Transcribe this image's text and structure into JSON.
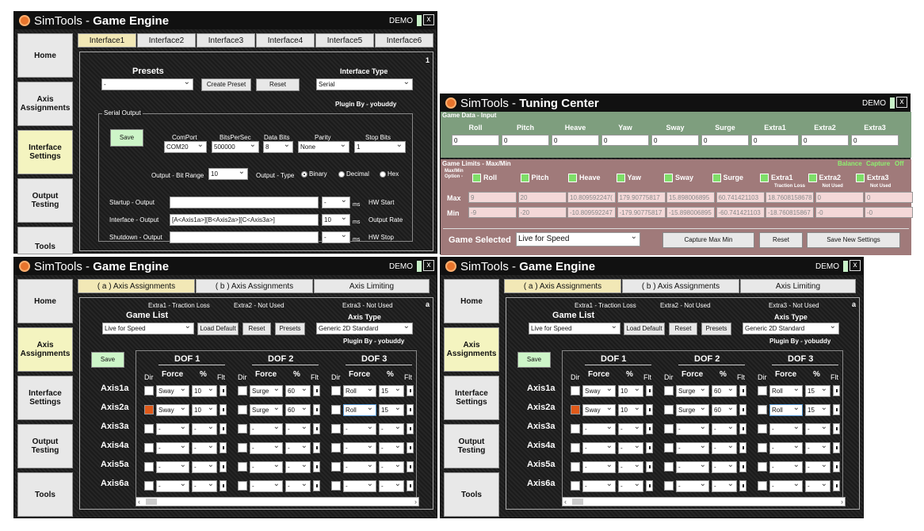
{
  "app": {
    "name": "SimTools",
    "game_engine": "Game Engine",
    "tuning_center": "Tuning Center",
    "demo": "DEMO",
    "close": "x"
  },
  "side_nav": [
    "Home",
    "Axis Assignments",
    "Interface Settings",
    "Output Testing",
    "Tools"
  ],
  "win1": {
    "tabs": [
      "Interface1",
      "Interface2",
      "Interface3",
      "Interface4",
      "Interface5",
      "Interface6"
    ],
    "page_num": "1",
    "presets_label": "Presets",
    "presets_value": "-",
    "create_preset": "Create Preset",
    "reset": "Reset",
    "interface_type_label": "Interface Type",
    "interface_type_value": "Serial",
    "plugin_by": "Plugin By - yobuddy",
    "serial_output": "Serial Output",
    "save": "Save",
    "comport_label": "ComPort",
    "comport": "COM20",
    "bps_label": "BitsPerSec",
    "bps": "500000",
    "databits_label": "Data Bits",
    "databits": "8",
    "parity_label": "Parity",
    "parity": "None",
    "stopbits_label": "Stop Bits",
    "stopbits": "1",
    "bitrange_label": "Output - Bit Range",
    "bitrange": "10",
    "outtype_label": "Output - Type",
    "binary": "Binary",
    "decimal": "Decimal",
    "hex": "Hex",
    "startup_label": "Startup - Output",
    "startup_value": "",
    "startup_ms": "-",
    "hw_start": "HW Start",
    "interface_label": "Interface - Output",
    "interface_value": "[A<Axis1a>][B<Axis2a>][C<Axis3a>]",
    "interface_ms": "10",
    "output_rate": "Output Rate",
    "shutdown_label": "Shutdown - Output",
    "shutdown_value": "",
    "shutdown_ms": "-",
    "hw_stop": "HW Stop",
    "ms": "ms"
  },
  "tuning": {
    "game_data_label": "Game Data - Input",
    "channels": [
      "Roll",
      "Pitch",
      "Heave",
      "Yaw",
      "Sway",
      "Surge",
      "Extra1",
      "Extra2",
      "Extra3"
    ],
    "inputs": [
      "0",
      "0",
      "0",
      "0",
      "0",
      "0",
      "0",
      "0",
      "0"
    ],
    "limits_label": "Game Limits - Max/Min",
    "balance": "Balance",
    "capture": "Capture",
    "off": "Off",
    "maxmin_option": "Max/Min Option -",
    "notes": [
      "",
      "",
      "",
      "",
      "",
      "",
      "Traction Loss",
      "Not Used",
      "Not Used"
    ],
    "max_label": "Max",
    "min_label": "Min",
    "max": [
      "9",
      "20",
      "10.809592247(",
      "179.90775817",
      "15.898006895",
      "60.741421103",
      "18.7608158678",
      "0",
      "0"
    ],
    "min": [
      "-9",
      "-20",
      "-10.809592247",
      "-179.90775817",
      "-15.898006895",
      "-60.741421103",
      "-18.760815867",
      "-0",
      "-0"
    ],
    "game_selected_label": "Game Selected",
    "game_selected": "Live for Speed",
    "capture_max_min": "Capture Max Min",
    "reset": "Reset",
    "save_new": "Save New Settings"
  },
  "axis": {
    "tabs": [
      "( a ) Axis Assignments",
      "( b ) Axis Assignments",
      "Axis Limiting"
    ],
    "page": "a",
    "extra1": "Extra1 - Traction Loss",
    "extra2": "Extra2 - Not Used",
    "extra3": "Extra3 - Not Used",
    "game_list": "Game List",
    "game_value": "Live for Speed",
    "load_default": "Load Default",
    "reset": "Reset",
    "presets": "Presets",
    "axis_type_label": "Axis Type",
    "axis_type": "Generic 2D Standard",
    "plugin_by": "Plugin By - yobuddy",
    "save": "Save",
    "dofs": [
      "DOF 1",
      "DOF 2",
      "DOF 3"
    ],
    "col_dir": "Dir",
    "col_force": "Force",
    "col_pct": "%",
    "col_flt": "Flt",
    "axes": [
      "Axis1a",
      "Axis2a",
      "Axis3a",
      "Axis4a",
      "Axis5a",
      "Axis6a"
    ],
    "rows": [
      {
        "dir": [
          false,
          false,
          false
        ],
        "force": [
          "Sway",
          "Surge",
          "Roll"
        ],
        "pct": [
          "10",
          "60",
          "15"
        ]
      },
      {
        "dir": [
          true,
          false,
          false
        ],
        "force": [
          "Sway",
          "Surge",
          "Roll"
        ],
        "pct": [
          "10",
          "60",
          "15"
        ]
      },
      {
        "dir": [
          false,
          false,
          false
        ],
        "force": [
          "-",
          "-",
          "-"
        ],
        "pct": [
          "-",
          "-",
          "-"
        ]
      },
      {
        "dir": [
          false,
          false,
          false
        ],
        "force": [
          "-",
          "-",
          "-"
        ],
        "pct": [
          "-",
          "-",
          "-"
        ]
      },
      {
        "dir": [
          false,
          false,
          false
        ],
        "force": [
          "-",
          "-",
          "-"
        ],
        "pct": [
          "-",
          "-",
          "-"
        ]
      },
      {
        "dir": [
          false,
          false,
          false
        ],
        "force": [
          "-",
          "-",
          "-"
        ],
        "pct": [
          "-",
          "-",
          "-"
        ]
      }
    ]
  }
}
